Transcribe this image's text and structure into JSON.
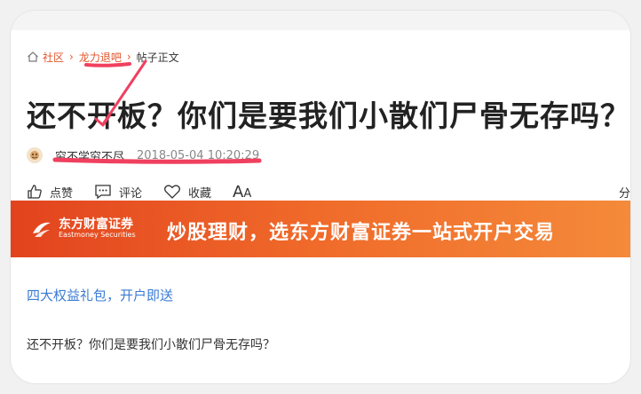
{
  "breadcrumb": {
    "items": [
      "社区",
      "龙力退吧"
    ],
    "current": "帖子正文"
  },
  "post": {
    "title": "还不开板？你们是要我们小散们尸骨无存吗？",
    "author": "穷不学穷不尽",
    "time": "2018-05-04 10:20:29",
    "body": "还不开板？你们是要我们小散们尸骨无存吗？"
  },
  "actions": {
    "like": "点赞",
    "comment": "评论",
    "favorite": "收藏",
    "font_big": "A",
    "font_small": "A",
    "share": "分"
  },
  "banner": {
    "logo_cn": "东方财富证券",
    "logo_en": "Eastmoney Securities",
    "text": "炒股理财，选东方财富证券一站式开户交易"
  },
  "promo": "四大权益礼包，开户即送",
  "colors": {
    "link": "#e2552b",
    "annotation": "#f0405f",
    "promo": "#3a7bd5"
  }
}
